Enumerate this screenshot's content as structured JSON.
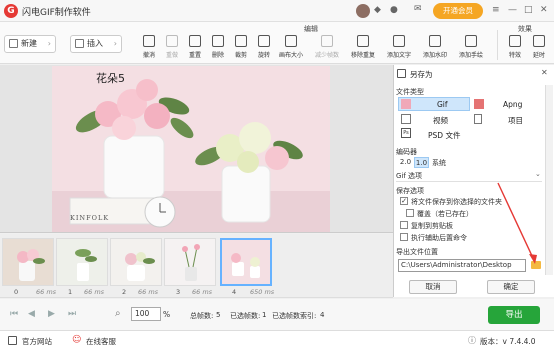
{
  "app": {
    "title": "闪电GIF制作软件",
    "logo_char": "G",
    "vip_label": "开通会员"
  },
  "toolbar": {
    "new_label": "新建",
    "insert_label": "插入",
    "groups": {
      "edit": "编辑",
      "effects": "效果"
    },
    "tools": [
      {
        "label": "撤消",
        "enabled": true
      },
      {
        "label": "重做",
        "enabled": false
      },
      {
        "label": "重置",
        "enabled": true
      },
      {
        "label": "删除",
        "enabled": true
      },
      {
        "label": "裁剪",
        "enabled": true
      },
      {
        "label": "旋转",
        "enabled": true
      },
      {
        "label": "画布大小",
        "enabled": true
      },
      {
        "label": "减少帧数",
        "enabled": false
      },
      {
        "label": "移除重复",
        "enabled": true
      },
      {
        "label": "添加文字",
        "enabled": true
      },
      {
        "label": "添加水印",
        "enabled": true
      },
      {
        "label": "添加手绘",
        "enabled": true
      },
      {
        "label": "特效",
        "enabled": true
      },
      {
        "label": "延时",
        "enabled": true
      }
    ]
  },
  "canvas": {
    "caption": "花朵5",
    "card_text": "KINFOLK"
  },
  "frames": [
    {
      "index": "0",
      "delay": "66 ms"
    },
    {
      "index": "1",
      "delay": "66 ms"
    },
    {
      "index": "2",
      "delay": "66 ms"
    },
    {
      "index": "3",
      "delay": "66 ms"
    },
    {
      "index": "4",
      "delay": "650 ms",
      "selected": true
    }
  ],
  "panel": {
    "title": "另存为",
    "file_type_label": "文件类型",
    "formats": {
      "gif": "Gif",
      "apng": "Apng",
      "video": "视频",
      "project": "项目",
      "psd": "PSD 文件"
    },
    "encoder_label": "编码器",
    "encoder_options": [
      "2.0",
      "1.0",
      "系统"
    ],
    "gif_options_label": "Gif 选项",
    "save_options_label": "保存选项",
    "checkboxes": [
      {
        "label": "将文件保存到你选择的文件夹",
        "checked": true
      },
      {
        "label": "覆盖（若已存在）",
        "checked": false
      },
      {
        "label": "复制到剪贴板",
        "checked": false
      },
      {
        "label": "执行辅助后置命令",
        "checked": false
      }
    ],
    "export_location_label": "导出文件位置",
    "path": "C:\\Users\\Administrator\\Desktop",
    "cancel_label": "取消",
    "ok_label": "确定"
  },
  "status": {
    "zoom": "100",
    "zoom_unit": "%",
    "total_frames_label": "总帧数:",
    "total_frames": "5",
    "selected_label": "已选帧数:",
    "selected": "1",
    "selected_index_label": "已选帧数索引:",
    "selected_index": "4",
    "export_label": "导出"
  },
  "footer": {
    "website": "官方网站",
    "support": "在线客服",
    "version": "版本：v 7.4.4.0"
  },
  "colors": {
    "accent": "#26a53a",
    "vip": "#f5a623",
    "logo": "#e53935",
    "selection": "#66b2ff",
    "annotation_arrow": "#e53935"
  }
}
